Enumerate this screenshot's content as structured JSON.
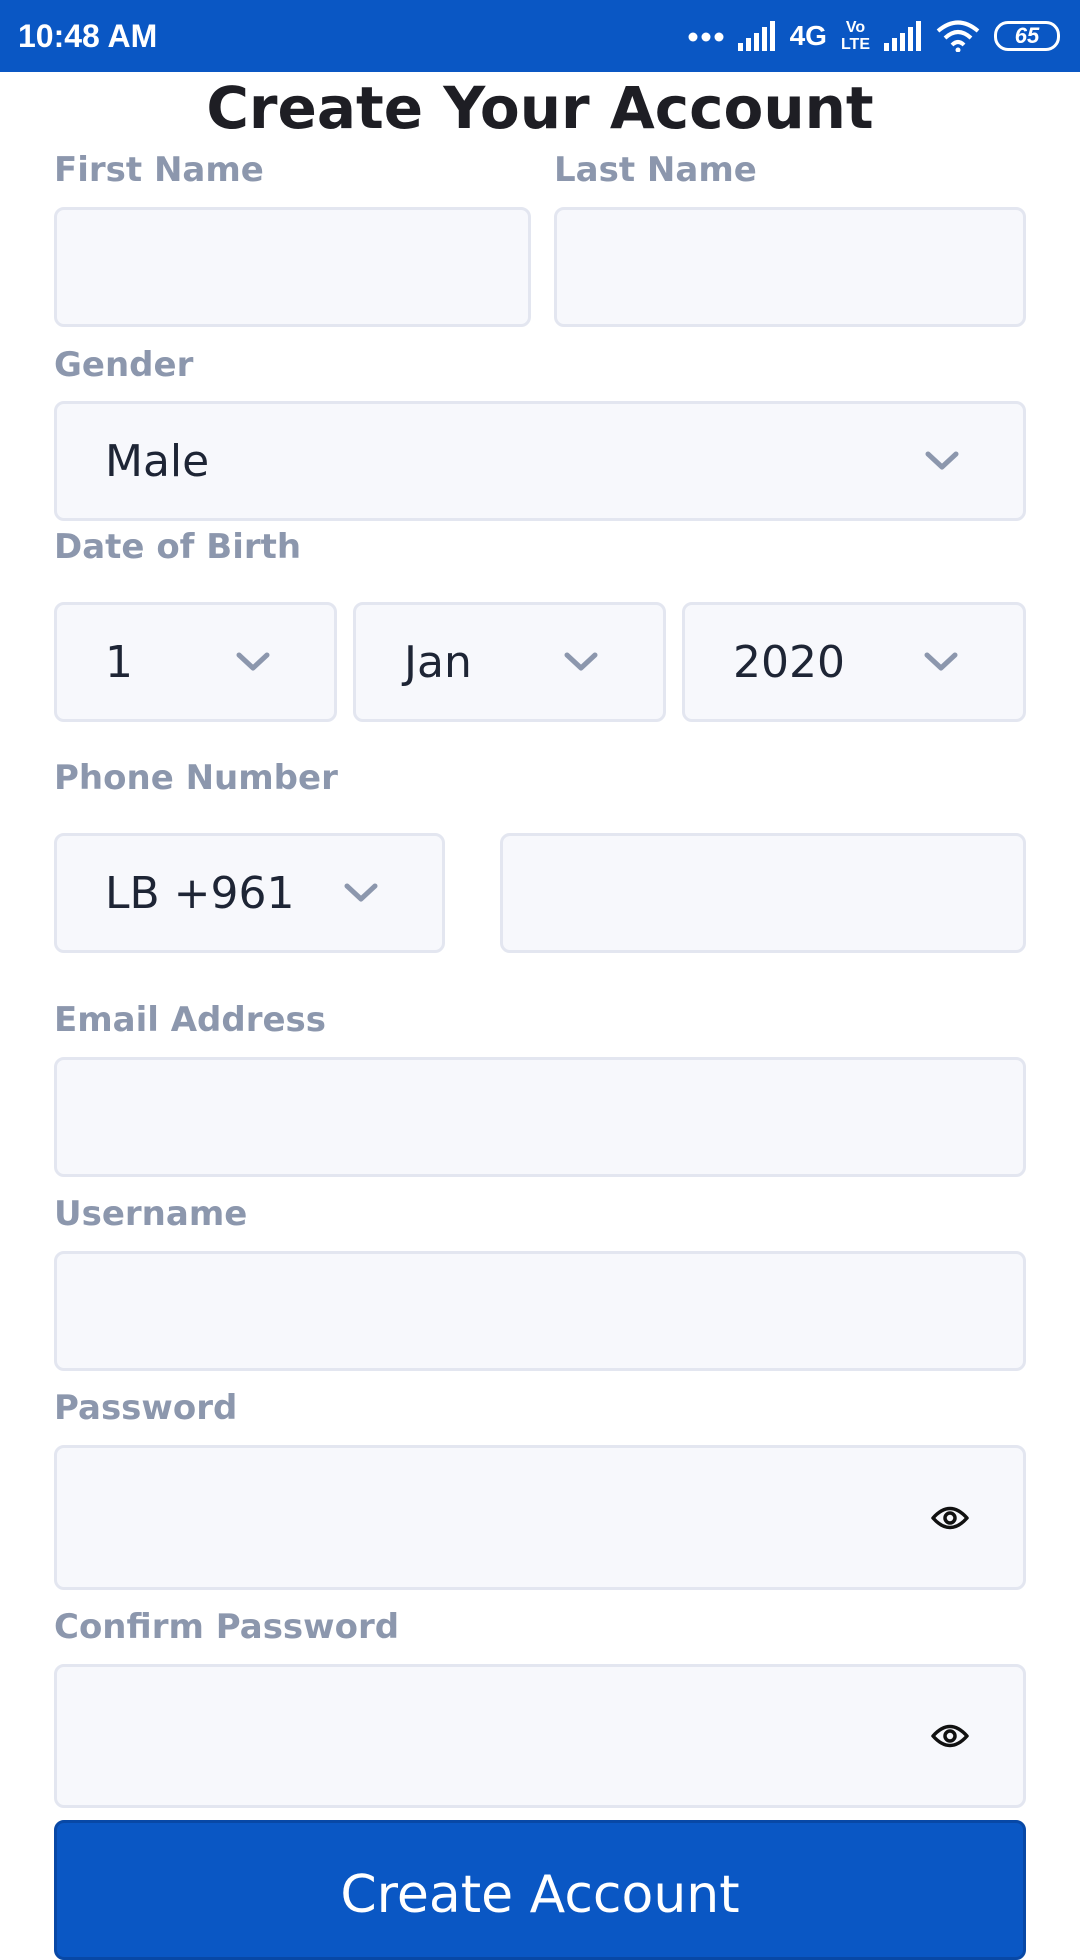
{
  "status_bar": {
    "time": "10:48 AM",
    "network": "4G",
    "volte_top": "Vo",
    "volte_bottom": "LTE",
    "battery": "65"
  },
  "form": {
    "title": "Create Your Account",
    "first_name": {
      "label": "First Name",
      "value": ""
    },
    "last_name": {
      "label": "Last Name",
      "value": ""
    },
    "gender": {
      "label": "Gender",
      "selected": "Male"
    },
    "date_of_birth": {
      "label": "Date of Birth",
      "day": "1",
      "month": "Jan",
      "year": "2020"
    },
    "phone": {
      "label": "Phone Number",
      "country_code": "LB +961",
      "number": ""
    },
    "email": {
      "label": "Email Address",
      "value": ""
    },
    "username": {
      "label": "Username",
      "value": ""
    },
    "password": {
      "label": "Password",
      "value": ""
    },
    "confirm_password": {
      "label": "Confirm Password",
      "value": ""
    },
    "submit_label": "Create Account"
  },
  "colors": {
    "primary": "#0a57c4",
    "label": "#8c97ad",
    "field_background": "#f7f8fc",
    "field_border": "#e3e6f0"
  },
  "icons": {
    "dropdown": "chevron-down-icon",
    "password_toggle": "eye-icon"
  }
}
